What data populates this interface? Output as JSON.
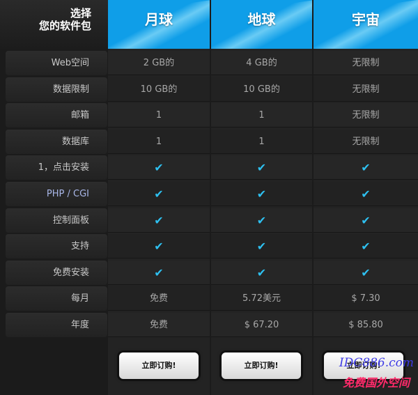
{
  "header": {
    "line1": "选择",
    "line2": "您的软件包",
    "plans": [
      "月球",
      "地球",
      "宇宙"
    ]
  },
  "rows": [
    {
      "label": "Web空间",
      "values": [
        "2 GB的",
        "4 GB的",
        "无限制"
      ]
    },
    {
      "label": "数据限制",
      "values": [
        "10 GB的",
        "10 GB的",
        "无限制"
      ]
    },
    {
      "label": "邮箱",
      "values": [
        "1",
        "1",
        "无限制"
      ]
    },
    {
      "label": "数据库",
      "values": [
        "1",
        "1",
        "无限制"
      ]
    },
    {
      "label": "1，点击安装",
      "values": [
        "✔",
        "✔",
        "✔"
      ]
    },
    {
      "label": "PHP / CGI",
      "values": [
        "✔",
        "✔",
        "✔"
      ]
    },
    {
      "label": "控制面板",
      "values": [
        "✔",
        "✔",
        "✔"
      ]
    },
    {
      "label": "支持",
      "values": [
        "✔",
        "✔",
        "✔"
      ]
    },
    {
      "label": "免费安装",
      "values": [
        "✔",
        "✔",
        "✔"
      ]
    },
    {
      "label": "每月",
      "values": [
        "免费",
        "5.72美元",
        "$ 7.30"
      ]
    },
    {
      "label": "年度",
      "values": [
        "免费",
        "$ 67.20",
        "$ 85.80"
      ]
    }
  ],
  "buttons": {
    "label": "立即订购!"
  },
  "watermark": {
    "line1": "IDC886.com",
    "line2": "免费国外空间"
  },
  "colors": {
    "header_blue": "#0f9ee8",
    "check_cyan": "#2ec0f0"
  }
}
